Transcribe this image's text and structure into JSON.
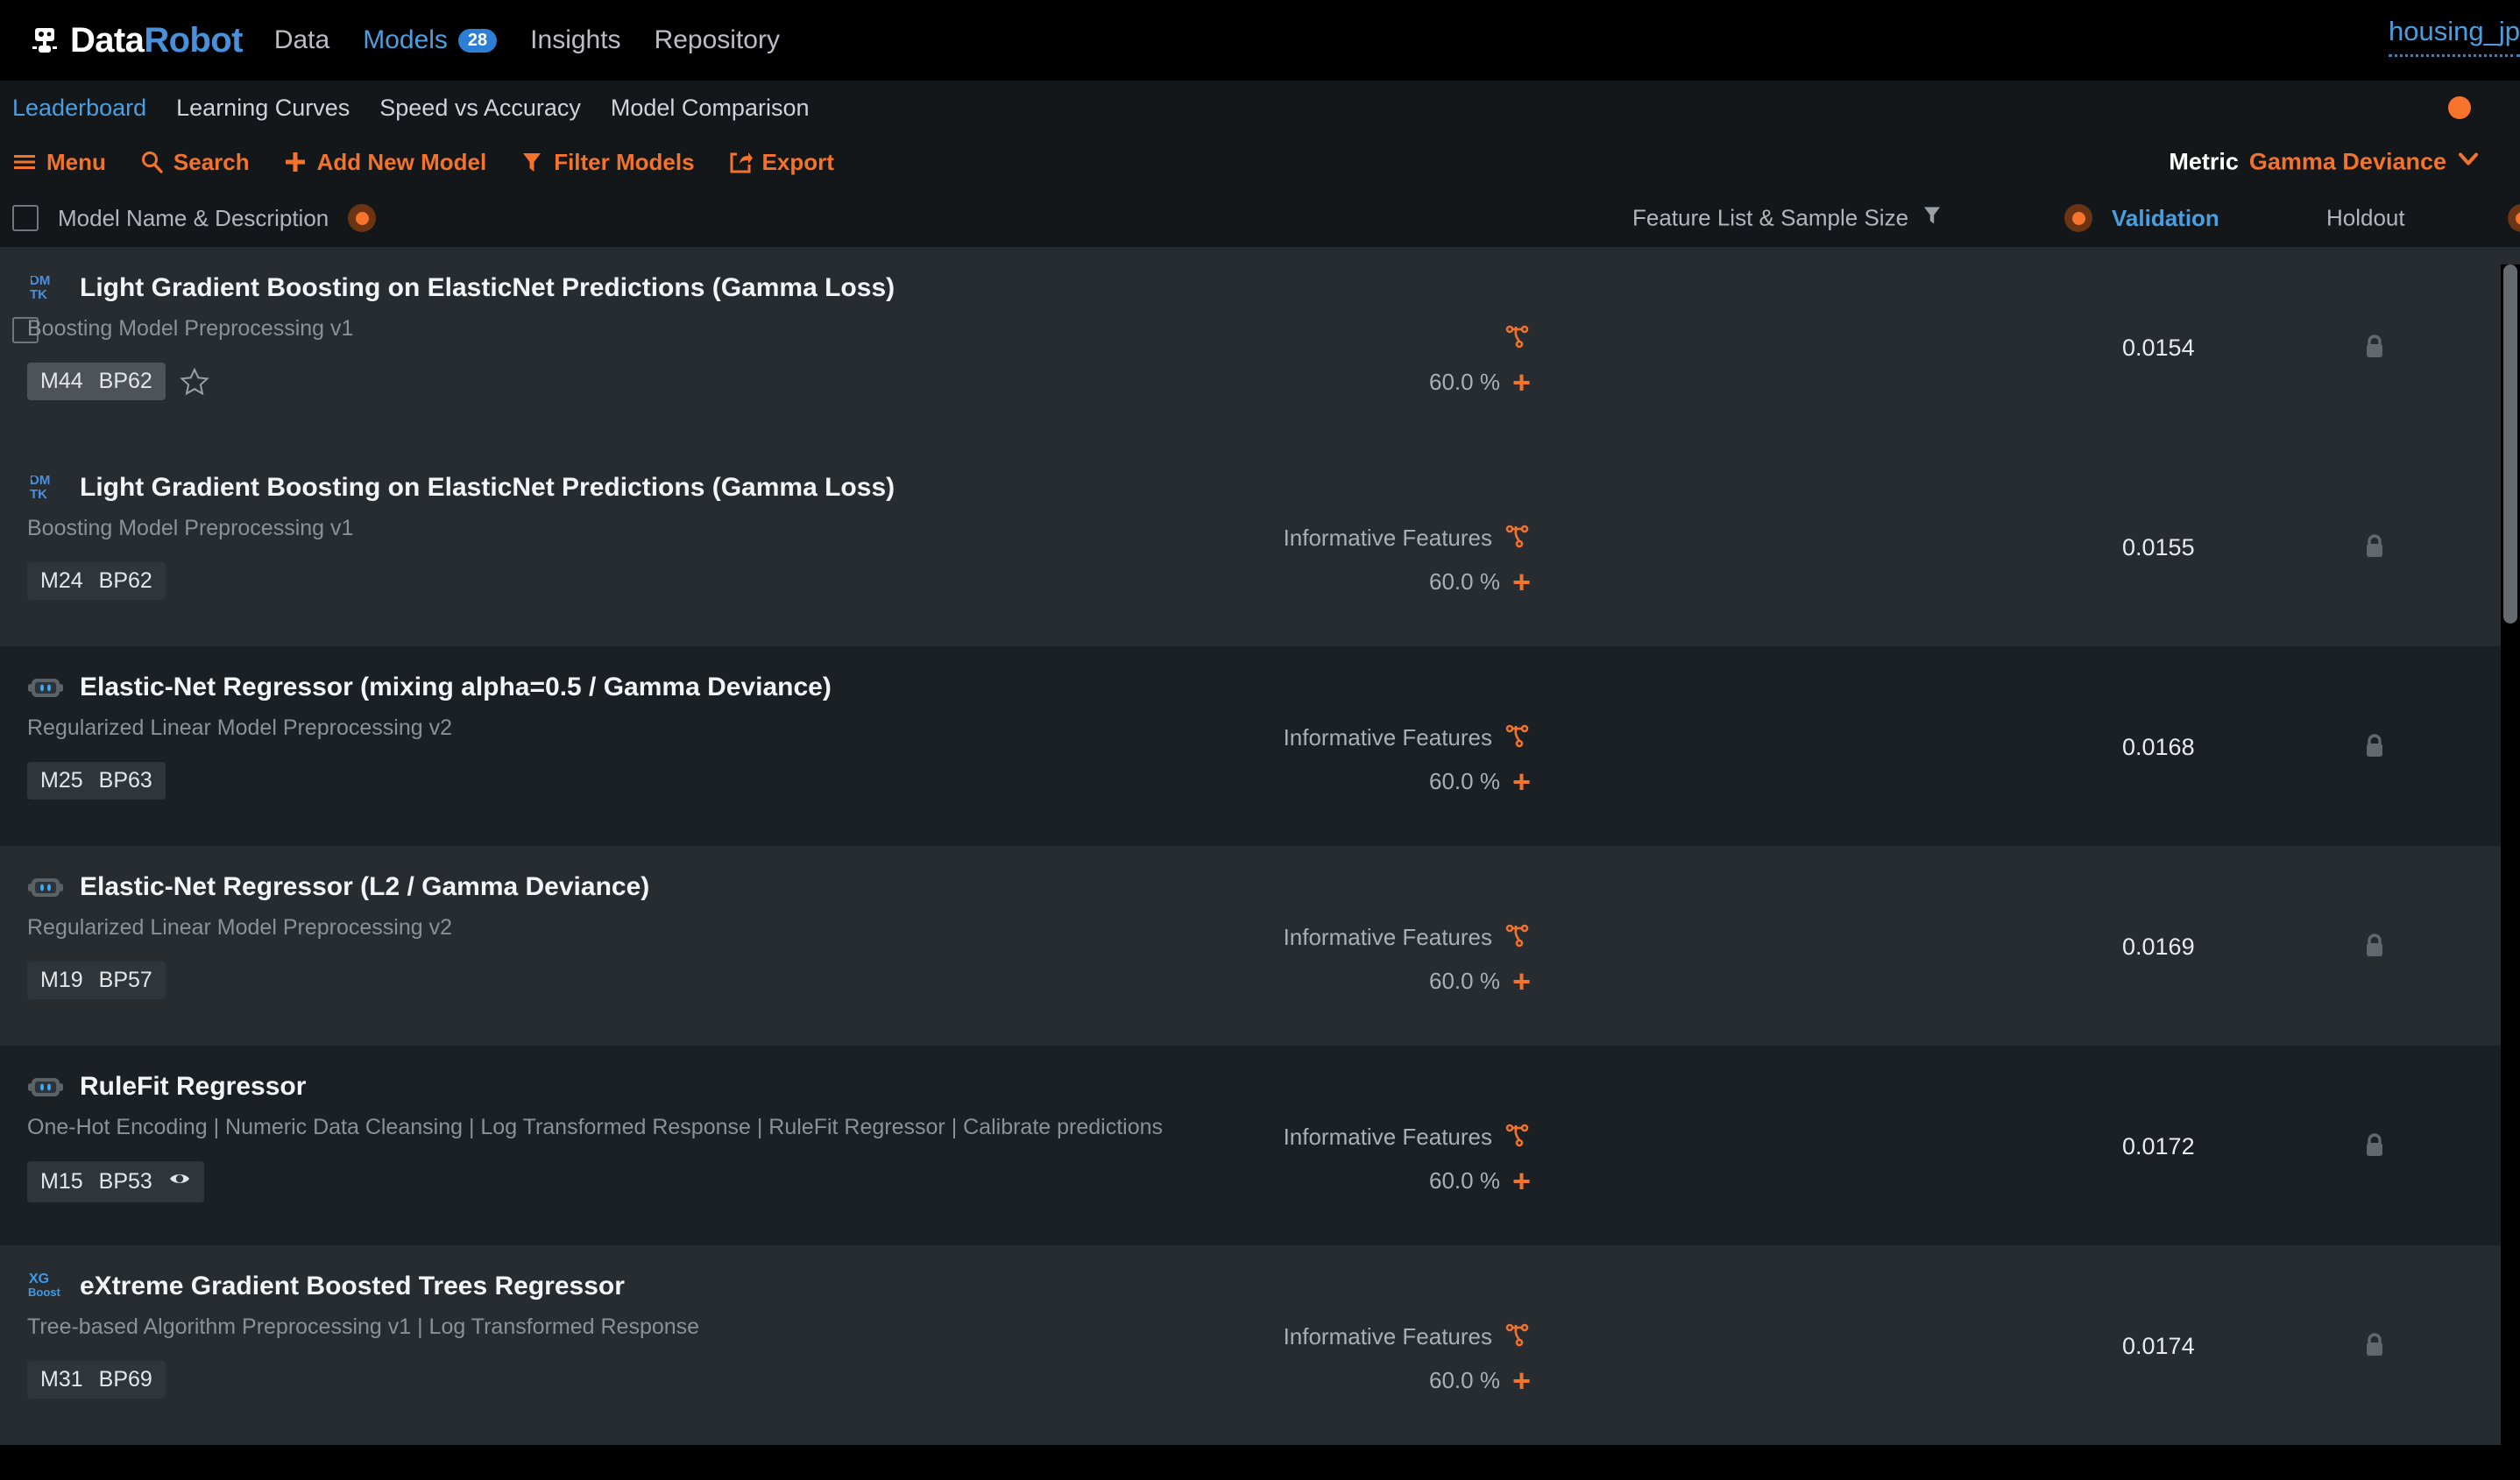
{
  "header": {
    "brand_data": "Data",
    "brand_robot": "Robot",
    "logo_icon": "robot-icon",
    "nav": [
      {
        "label": "Data",
        "active": false,
        "badge": null
      },
      {
        "label": "Models",
        "active": true,
        "badge": "28"
      },
      {
        "label": "Insights",
        "active": false,
        "badge": null
      },
      {
        "label": "Repository",
        "active": false,
        "badge": null
      }
    ],
    "project_name": "housing_jp"
  },
  "subtabs": [
    {
      "label": "Leaderboard",
      "active": true
    },
    {
      "label": "Learning Curves",
      "active": false
    },
    {
      "label": "Speed vs Accuracy",
      "active": false
    },
    {
      "label": "Model Comparison",
      "active": false
    }
  ],
  "toolbar": {
    "items": [
      {
        "label": "Menu",
        "icon": "hamburger-icon"
      },
      {
        "label": "Search",
        "icon": "search-icon"
      },
      {
        "label": "Add New Model",
        "icon": "plus-icon"
      },
      {
        "label": "Filter Models",
        "icon": "funnel-icon"
      },
      {
        "label": "Export",
        "icon": "export-icon"
      }
    ],
    "metric_label": "Metric",
    "metric_value": "Gamma Deviance",
    "metric_caret": "chevron-down-icon"
  },
  "columns": {
    "model_name": "Model Name & Description",
    "feature_list": "Feature List & Sample Size",
    "validation": "Validation",
    "holdout": "Holdout"
  },
  "colors": {
    "accent_orange": "#f4732b",
    "accent_blue": "#4a9fe0",
    "row_alt": "#272c30",
    "row_base": "#1b2024",
    "chrome": "#13171a"
  },
  "rows": [
    {
      "icon": "lightgbm-dmtk-icon",
      "title": "Light Gradient Boosting on ElasticNet Predictions (Gamma Loss)",
      "description": "Boosting Model Preprocessing v1",
      "badge_model": "M44",
      "badge_blueprint": "BP62",
      "badge_eye": false,
      "badge_dim": false,
      "starred": true,
      "checkbox": true,
      "feature_list": "",
      "sample_size": "60.0 %",
      "validation": "0.0154",
      "holdout_locked": true,
      "shade": "alt"
    },
    {
      "icon": "lightgbm-dmtk-icon",
      "title": "Light Gradient Boosting on ElasticNet Predictions (Gamma Loss)",
      "description": "Boosting Model Preprocessing v1",
      "badge_model": "M24",
      "badge_blueprint": "BP62",
      "badge_eye": false,
      "badge_dim": true,
      "starred": false,
      "checkbox": false,
      "feature_list": "Informative Features",
      "sample_size": "60.0 %",
      "validation": "0.0155",
      "holdout_locked": true,
      "shade": "alt"
    },
    {
      "icon": "datarobot-model-icon",
      "title": "Elastic-Net Regressor (mixing alpha=0.5 / Gamma Deviance)",
      "description": "Regularized Linear Model Preprocessing v2",
      "badge_model": "M25",
      "badge_blueprint": "BP63",
      "badge_eye": false,
      "badge_dim": true,
      "starred": false,
      "checkbox": false,
      "feature_list": "Informative Features",
      "sample_size": "60.0 %",
      "validation": "0.0168",
      "holdout_locked": true,
      "shade": "base"
    },
    {
      "icon": "datarobot-model-icon",
      "title": "Elastic-Net Regressor (L2 / Gamma Deviance)",
      "description": "Regularized Linear Model Preprocessing v2",
      "badge_model": "M19",
      "badge_blueprint": "BP57",
      "badge_eye": false,
      "badge_dim": true,
      "starred": false,
      "checkbox": false,
      "feature_list": "Informative Features",
      "sample_size": "60.0 %",
      "validation": "0.0169",
      "holdout_locked": true,
      "shade": "alt"
    },
    {
      "icon": "datarobot-model-icon",
      "title": "RuleFit Regressor",
      "description": "One-Hot Encoding | Numeric Data Cleansing | Log Transformed Response | RuleFit Regressor | Calibrate predictions",
      "badge_model": "M15",
      "badge_blueprint": "BP53",
      "badge_eye": true,
      "badge_dim": true,
      "starred": false,
      "checkbox": false,
      "feature_list": "Informative Features",
      "sample_size": "60.0 %",
      "validation": "0.0172",
      "holdout_locked": true,
      "shade": "base"
    },
    {
      "icon": "xgboost-icon",
      "title": "eXtreme Gradient Boosted Trees Regressor",
      "description": "Tree-based Algorithm Preprocessing v1 | Log Transformed Response",
      "badge_model": "M31",
      "badge_blueprint": "BP69",
      "badge_eye": false,
      "badge_dim": true,
      "starred": false,
      "checkbox": false,
      "feature_list": "Informative Features",
      "sample_size": "60.0 %",
      "validation": "0.0174",
      "holdout_locked": true,
      "shade": "alt"
    }
  ]
}
